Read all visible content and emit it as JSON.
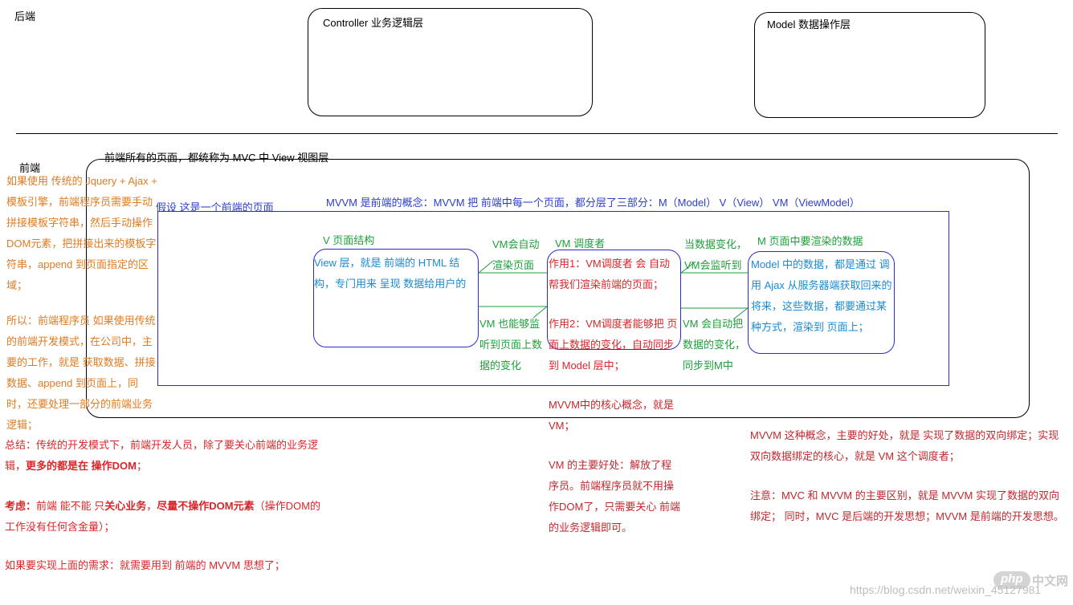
{
  "labels": {
    "backend": "后端",
    "frontend": "前端",
    "controller": "Controller 业务逻辑层",
    "model": "Model 数据操作层",
    "view_layer": "前端所有的页面，都统称为 MVC 中 View 视图层",
    "assume_page": "假设 这是一个前端的页面",
    "mvvm_concept": "MVVM 是前端的概念：MVVM 把 前端中每一个页面，都分层了三部分：M（Model） V（View） VM（ViewModel）"
  },
  "v_section": {
    "title": "V 页面结构",
    "body": "View 层，就是 前端的 HTML 结构，专门用来 呈现 数据给用户的"
  },
  "vm_section": {
    "title": "VM 调度者",
    "body1": "作用1：VM调度者 会 自动帮我们渲染前端的页面；",
    "body2": "作用2：VM调度者能够把 页面上数据的变化，自动同步到 Model 层中；"
  },
  "m_section": {
    "title": "M 页面中要渲染的数据",
    "body": "Model 中的数据，都是通过 调用 Ajax 从服务器端获取回来的将来，这些数据，都要通过某种方式，渲染到 页面上；"
  },
  "arrows": {
    "vm_render": "VM会自动渲染页面",
    "vm_listen": "VM 也能够监听到页面上数据的变化",
    "data_change": "当数据变化，VM会监听到",
    "vm_sync": "VM 会自动把数据的变化，同步到M中"
  },
  "left_notes": {
    "p1": "如果使用 传统的 Jquery + Ajax + 模板引擎，前端程序员需要手动拼接模板字符串，然后手动操作DOM元素，把拼接出来的模板字符串，append 到页面指定的区域；",
    "p2": "所以：前端程序员 如果使用传统的前端开发模式，在公司中，主要的工作，就是 获取数据、拼接数据、append 到页面上，同时，还要处理一部分的前端业务逻辑；"
  },
  "summary": {
    "s1a": "总结：传统的开发模式下，前端开发人员，除了要关心前端的业务逻辑，",
    "s1b": "更多的都是在 操作DOM",
    "s1c": "；",
    "s2a": "考虑：",
    "s2b": "前端 能不能 只",
    "s2c": "关心业务",
    "s2d": "，",
    "s2e": "尽量不操作DOM元素",
    "s2f": "（操作DOM的工作没有任何含金量）；",
    "s3": "如果要实现上面的需求：就需要用到 前端的 MVVM 思想了；"
  },
  "middle_notes": {
    "m1": "MVVM中的核心概念，就是 VM；",
    "m2": "VM 的主要好处：解放了程序员。前端程序员就不用操作DOM了，只需要关心 前端的业务逻辑即可。"
  },
  "right_notes": {
    "r1": "MVVM 这种概念，主要的好处，就是 实现了数据的双向绑定；实现双向数据绑定的核心，就是 VM 这个调度者；",
    "r2": "注意：MVC 和 MVVM 的主要区别，就是 MVVM 实现了数据的双向绑定； 同时，MVC 是后端的开发思想；MVVM 是前端的开发思想。"
  },
  "watermark": {
    "logo": "php",
    "logo_cn": "中文网",
    "url": "https://blog.csdn.net/weixin_45127981"
  },
  "colors": {
    "orange": "#e07b20",
    "red": "#d8262a",
    "green": "#1e9e3a",
    "blue": "#2b3ec8",
    "cyan": "#1a8ad0"
  }
}
